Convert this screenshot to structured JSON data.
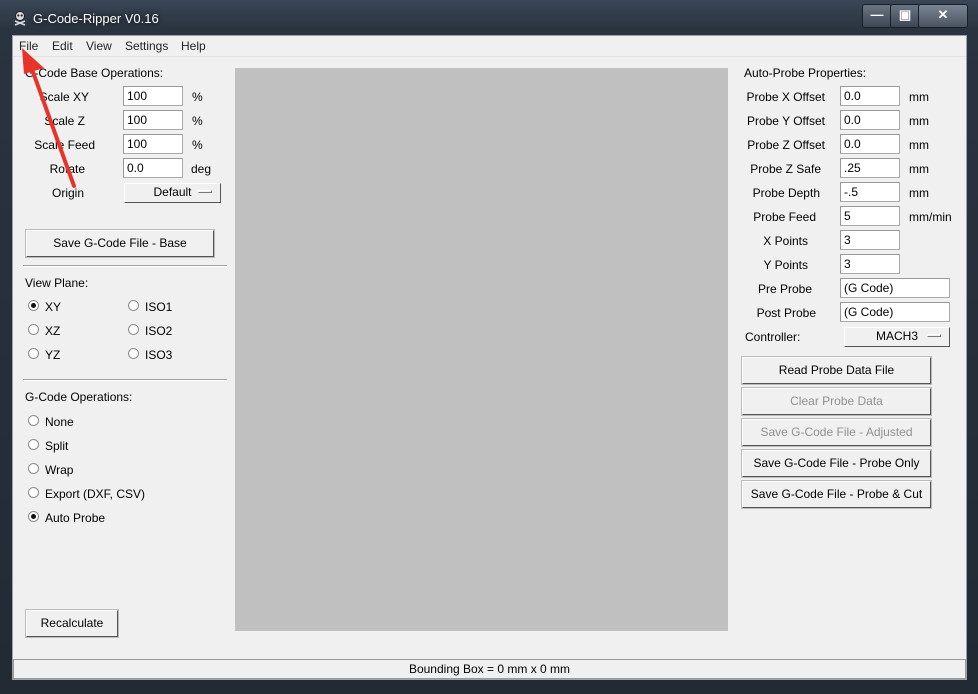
{
  "window": {
    "title": "G-Code-Ripper V0.16",
    "controls": {
      "minimize": "—",
      "maximize": "▣",
      "close": "✕"
    }
  },
  "menu": [
    "File",
    "Edit",
    "View",
    "Settings",
    "Help"
  ],
  "base_ops": {
    "heading": "G-Code Base Operations:",
    "fields": [
      {
        "label": "Scale XY",
        "value": "100",
        "unit": "%"
      },
      {
        "label": "Scale Z",
        "value": "100",
        "unit": "%"
      },
      {
        "label": "Scale Feed",
        "value": "100",
        "unit": "%"
      },
      {
        "label": "Rotate",
        "value": "0.0",
        "unit": "deg"
      }
    ],
    "origin_label": "Origin",
    "origin_value": "Default",
    "save_button": "Save G-Code File - Base"
  },
  "view_plane": {
    "heading": "View Plane:",
    "options": [
      {
        "label": "XY",
        "selected": true
      },
      {
        "label": "ISO1",
        "selected": false
      },
      {
        "label": "XZ",
        "selected": false
      },
      {
        "label": "ISO2",
        "selected": false
      },
      {
        "label": "YZ",
        "selected": false
      },
      {
        "label": "ISO3",
        "selected": false
      }
    ]
  },
  "gcode_ops": {
    "heading": "G-Code Operations:",
    "options": [
      {
        "label": "None",
        "selected": false
      },
      {
        "label": "Split",
        "selected": false
      },
      {
        "label": "Wrap",
        "selected": false
      },
      {
        "label": "Export (DXF, CSV)",
        "selected": false
      },
      {
        "label": "Auto Probe",
        "selected": true
      }
    ]
  },
  "recalculate_button": "Recalculate",
  "probe": {
    "heading": "Auto-Probe Properties:",
    "fields": [
      {
        "label": "Probe X Offset",
        "value": "0.0",
        "unit": "mm"
      },
      {
        "label": "Probe Y Offset",
        "value": "0.0",
        "unit": "mm"
      },
      {
        "label": "Probe Z Offset",
        "value": "0.0",
        "unit": "mm"
      },
      {
        "label": "Probe Z Safe",
        "value": ".25",
        "unit": "mm"
      },
      {
        "label": "Probe Depth",
        "value": "-.5",
        "unit": "mm"
      },
      {
        "label": "Probe Feed",
        "value": "5",
        "unit": "mm/min"
      },
      {
        "label": "X Points",
        "value": "3",
        "unit": ""
      },
      {
        "label": "Y Points",
        "value": "3",
        "unit": ""
      },
      {
        "label": "Pre Probe",
        "value": "(G Code)",
        "unit": ""
      },
      {
        "label": "Post Probe",
        "value": "(G Code)",
        "unit": ""
      }
    ],
    "controller_label": "Controller:",
    "controller_value": "MACH3",
    "buttons": [
      {
        "label": "Read Probe Data File",
        "enabled": true
      },
      {
        "label": "Clear Probe Data",
        "enabled": false
      },
      {
        "label": "Save G-Code File - Adjusted",
        "enabled": false
      },
      {
        "label": "Save G-Code File - Probe Only",
        "enabled": true
      },
      {
        "label": "Save G-Code File - Probe & Cut",
        "enabled": true
      }
    ]
  },
  "status_bar": "Bounding Box = 0 mm  x 0 mm",
  "annotation": {
    "color": "#e8332a",
    "points_to": "File"
  }
}
